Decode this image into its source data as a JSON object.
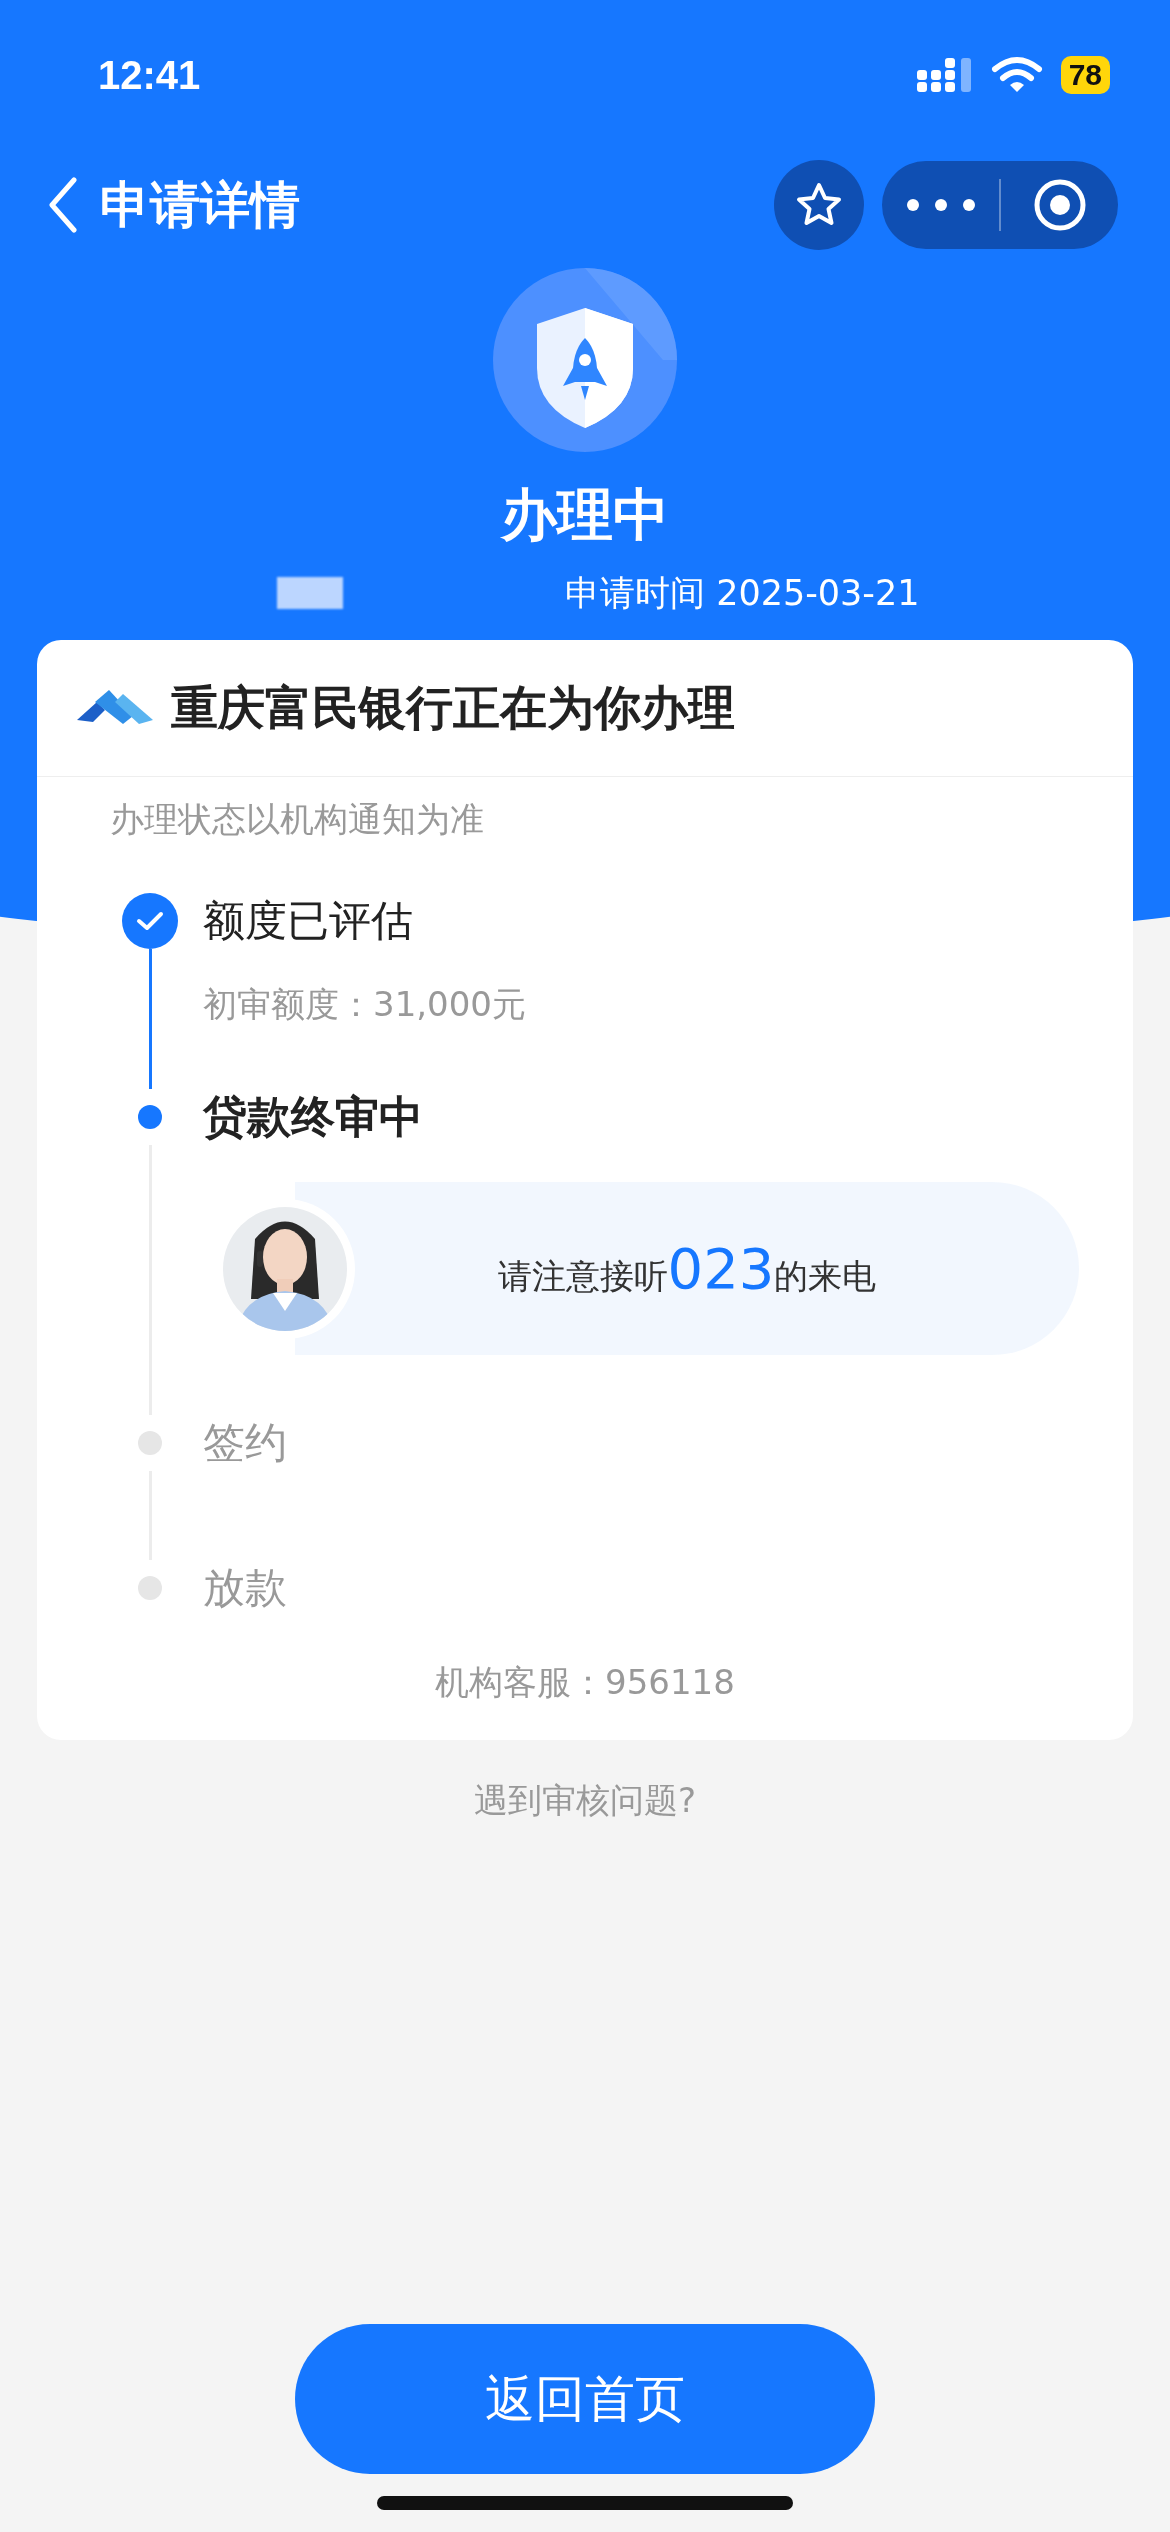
{
  "status_bar": {
    "time": "12:41",
    "battery": "78"
  },
  "nav": {
    "title": "申请详情"
  },
  "status": {
    "title": "办理中",
    "applied": "申请时间 2025-03-21"
  },
  "card": {
    "institution": "重庆富民银行正在为你办理",
    "notice": "办理状态以机构通知为准",
    "steps": [
      {
        "title": "额度已评估",
        "kind": "done",
        "detail": "初审额度：31,000元"
      },
      {
        "title": "贷款终审中",
        "kind": "current",
        "call_notice": {
          "before": "请注意接听",
          "number": "023",
          "after": "的来电"
        }
      },
      {
        "title": "签约",
        "kind": "pending"
      },
      {
        "title": "放款",
        "kind": "pending"
      }
    ],
    "service": "机构客服：956118"
  },
  "help_link": "遇到审核问题?",
  "home_button": "返回首页"
}
